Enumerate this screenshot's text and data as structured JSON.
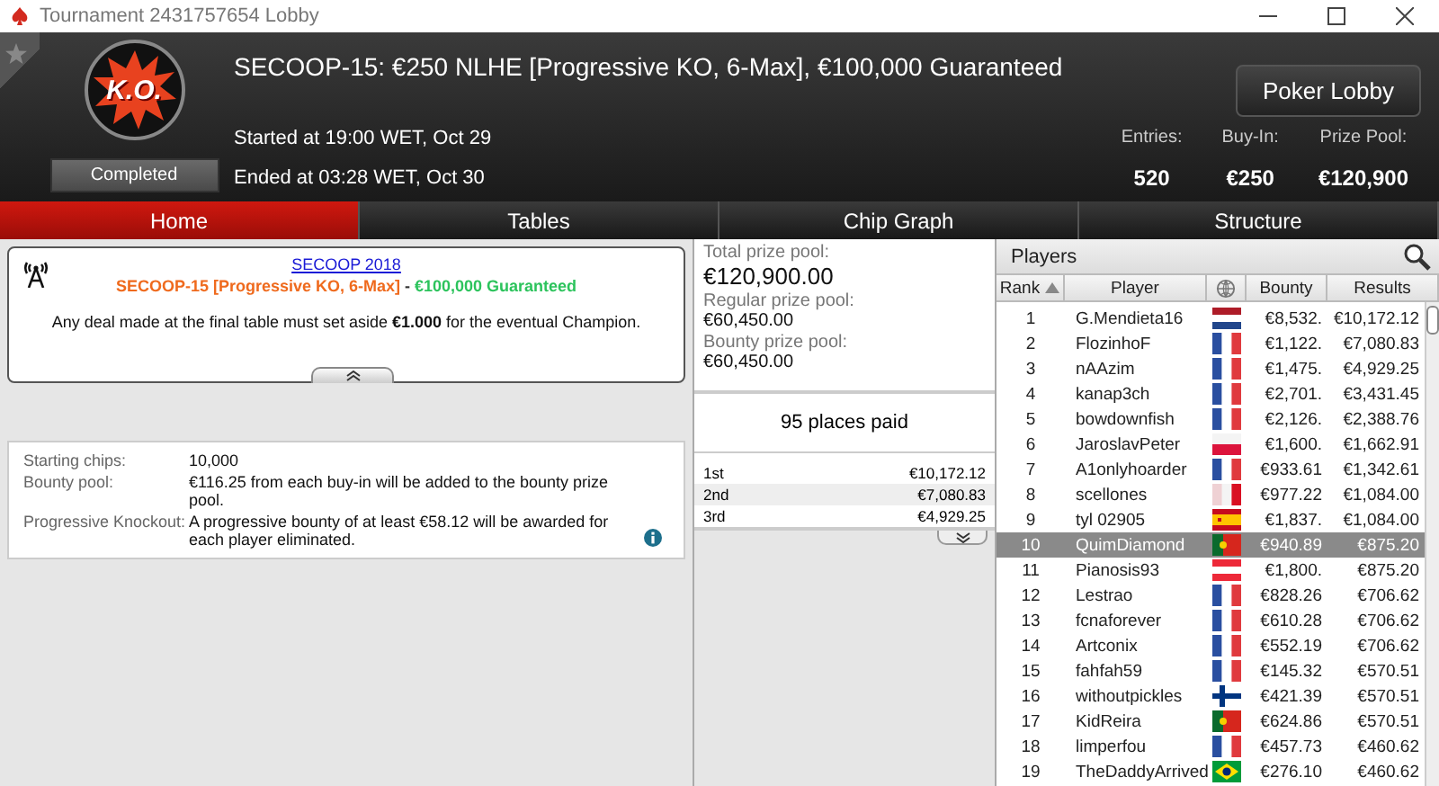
{
  "window": {
    "title": "Tournament 2431757654 Lobby"
  },
  "header": {
    "title": "SECOOP-15: €250 NLHE [Progressive KO, 6-Max], €100,000 Guaranteed",
    "badge": "K.O.",
    "status": "Completed",
    "started": "Started at 19:00 WET, Oct 29",
    "ended": "Ended at 03:28 WET, Oct 30",
    "lobby_button": "Poker Lobby",
    "stats": [
      {
        "label": "Entries:",
        "value": "520"
      },
      {
        "label": "Buy-In:",
        "value": "€250"
      },
      {
        "label": "Prize Pool:",
        "value": "€120,900"
      }
    ]
  },
  "tabs": [
    {
      "label": "Home",
      "selected": true
    },
    {
      "label": "Tables",
      "selected": false
    },
    {
      "label": "Chip Graph",
      "selected": false
    },
    {
      "label": "Structure",
      "selected": false
    }
  ],
  "info": {
    "link": "SECOOP 2018",
    "event": "SECOOP-15 [Progressive KO, 6-Max]",
    "separator": " - ",
    "guarantee": "€100,000 Guaranteed",
    "notice": "Any deal made at the final table must set aside **€1.000** for the eventual Champion."
  },
  "details": [
    {
      "label": "Starting chips:",
      "value": "10,000"
    },
    {
      "label": "Bounty pool:",
      "value": "€116.25 from each buy-in will be added to the bounty prize pool."
    },
    {
      "label": "Progressive Knockout:",
      "value": "A progressive bounty of at least €58.12 will be awarded for each player eliminated."
    }
  ],
  "prizes": {
    "pools": [
      {
        "label": "Total prize pool:",
        "value": "€120,900.00"
      },
      {
        "label": "Regular prize pool:",
        "value": "€60,450.00"
      },
      {
        "label": "Bounty prize pool:",
        "value": "€60,450.00"
      }
    ],
    "places_paid": "95 places paid",
    "payouts": [
      {
        "place": "1st",
        "amount": "€10,172.12"
      },
      {
        "place": "2nd",
        "amount": "€7,080.83"
      },
      {
        "place": "3rd",
        "amount": "€4,929.25"
      }
    ]
  },
  "players": {
    "title": "Players",
    "columns": [
      "Rank",
      "Player",
      "Bounty",
      "Results"
    ],
    "rows": [
      {
        "rank": "1",
        "player": "G.Mendieta16",
        "flag": {
          "kind": "nl"
        },
        "bounty": "€8,532.",
        "result": "€10,172.12",
        "selected": false
      },
      {
        "rank": "2",
        "player": "FlozinhoF",
        "flag": {
          "kind": "fr"
        },
        "bounty": "€1,122.",
        "result": "€7,080.83",
        "selected": false
      },
      {
        "rank": "3",
        "player": "nAAzim",
        "flag": {
          "kind": "fr"
        },
        "bounty": "€1,475.",
        "result": "€4,929.25",
        "selected": false
      },
      {
        "rank": "4",
        "player": "kanap3ch",
        "flag": {
          "kind": "fr"
        },
        "bounty": "€2,701.",
        "result": "€3,431.45",
        "selected": false
      },
      {
        "rank": "5",
        "player": "bowdownfish",
        "flag": {
          "kind": "fr"
        },
        "bounty": "€2,126.",
        "result": "€2,388.76",
        "selected": false
      },
      {
        "rank": "6",
        "player": "JaroslavPeter",
        "flag": {
          "kind": "pl"
        },
        "bounty": "€1,600.",
        "result": "€1,662.91",
        "selected": false
      },
      {
        "rank": "7",
        "player": "A1onlyhoarder",
        "flag": {
          "kind": "fr"
        },
        "bounty": "€933.61",
        "result": "€1,342.61",
        "selected": false
      },
      {
        "rank": "8",
        "player": "scellones",
        "flag": {
          "kind": "pe"
        },
        "bounty": "€977.22",
        "result": "€1,084.00",
        "selected": false
      },
      {
        "rank": "9",
        "player": "tyl 02905",
        "flag": {
          "kind": "es"
        },
        "bounty": "€1,837.",
        "result": "€1,084.00",
        "selected": false
      },
      {
        "rank": "10",
        "player": "QuimDiamond",
        "flag": {
          "kind": "pt"
        },
        "bounty": "€940.89",
        "result": "€875.20",
        "selected": true
      },
      {
        "rank": "11",
        "player": "Pianosis93",
        "flag": {
          "kind": "at"
        },
        "bounty": "€1,800.",
        "result": "€875.20",
        "selected": false
      },
      {
        "rank": "12",
        "player": "Lestrao",
        "flag": {
          "kind": "fr"
        },
        "bounty": "€828.26",
        "result": "€706.62",
        "selected": false
      },
      {
        "rank": "13",
        "player": "fcnaforever",
        "flag": {
          "kind": "fr"
        },
        "bounty": "€610.28",
        "result": "€706.62",
        "selected": false
      },
      {
        "rank": "14",
        "player": "Artconix",
        "flag": {
          "kind": "fr"
        },
        "bounty": "€552.19",
        "result": "€706.62",
        "selected": false
      },
      {
        "rank": "15",
        "player": "fahfah59",
        "flag": {
          "kind": "fr"
        },
        "bounty": "€145.32",
        "result": "€570.51",
        "selected": false
      },
      {
        "rank": "16",
        "player": "withoutpickles",
        "flag": {
          "kind": "fi"
        },
        "bounty": "€421.39",
        "result": "€570.51",
        "selected": false
      },
      {
        "rank": "17",
        "player": "KidReira",
        "flag": {
          "kind": "pt"
        },
        "bounty": "€624.86",
        "result": "€570.51",
        "selected": false
      },
      {
        "rank": "18",
        "player": "limperfou",
        "flag": {
          "kind": "fr"
        },
        "bounty": "€457.73",
        "result": "€460.62",
        "selected": false
      },
      {
        "rank": "19",
        "player": "TheDaddyArrived",
        "flag": {
          "kind": "br"
        },
        "bounty": "€276.10",
        "result": "€460.62",
        "selected": false
      }
    ]
  }
}
